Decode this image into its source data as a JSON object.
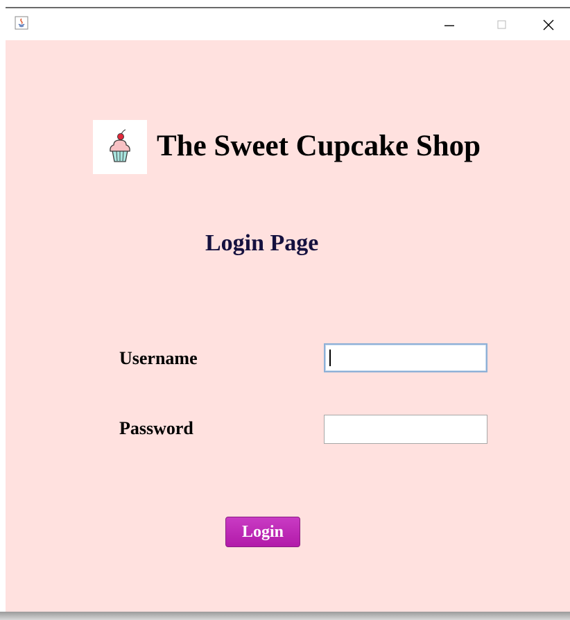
{
  "window": {
    "app_icon": "java-icon",
    "controls": {
      "minimize_icon": "minimize-icon",
      "maximize_icon": "maximize-icon",
      "close_icon": "close-icon"
    }
  },
  "header": {
    "logo_icon": "cupcake-icon",
    "shop_title": "The Sweet Cupcake Shop",
    "page_title": "Login Page"
  },
  "form": {
    "username_label": "Username",
    "username_value": "",
    "password_label": "Password",
    "password_value": "",
    "login_label": "Login"
  },
  "colors": {
    "background": "#ffe1df",
    "page_title": "#15113f",
    "login_button": "#b21aa9",
    "focus_border": "#8eb0d6"
  }
}
